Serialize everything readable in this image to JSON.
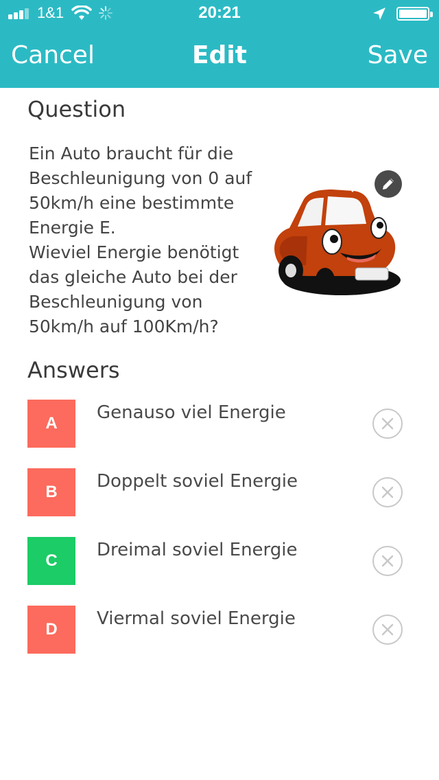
{
  "status_bar": {
    "carrier": "1&1",
    "time": "20:21",
    "battery_level": 1.0
  },
  "nav": {
    "cancel_label": "Cancel",
    "title": "Edit",
    "save_label": "Save"
  },
  "colors": {
    "header": "#2bbac4",
    "wrong": "#fc6b5d",
    "correct": "#1ccc66"
  },
  "question": {
    "heading": "Question",
    "text": "Ein Auto braucht für die\nBeschleunigung von 0 auf\n50km/h eine bestimmte\nEnergie E.\nWieviel Energie benötigt\ndas gleiche Auto bei der\nBeschleunigung von\n50km/h auf 100Km/h?",
    "image_icon": "cartoon-car",
    "edit_icon": "pencil-icon"
  },
  "answers": {
    "heading": "Answers",
    "items": [
      {
        "letter": "A",
        "text": "Genauso viel Energie",
        "correct": false
      },
      {
        "letter": "B",
        "text": "Doppelt soviel Energie",
        "correct": false
      },
      {
        "letter": "C",
        "text": "Dreimal soviel Energie",
        "correct": true
      },
      {
        "letter": "D",
        "text": "Viermal soviel Energie",
        "correct": false
      }
    ]
  }
}
